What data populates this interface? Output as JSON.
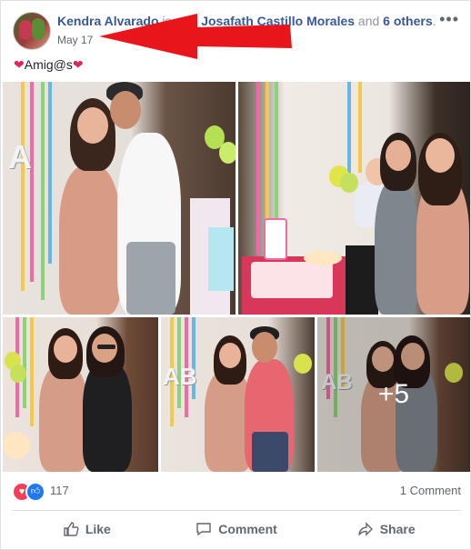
{
  "post": {
    "author": "Kendra Alvarado",
    "with_text": "is with",
    "tagged": "Josafath Castillo Morales",
    "and_text": "and",
    "others": "6 others",
    "end_punct": ".",
    "date": "May 17",
    "caption_text": "Amig@s",
    "more_icon": "ellipsis-icon"
  },
  "photos": {
    "overflow_label": "+5",
    "count_visible": 5
  },
  "reactions": {
    "icons": [
      "love-icon",
      "like-icon"
    ],
    "count": "117",
    "comments": "1 Comment"
  },
  "actions": {
    "like": "Like",
    "comment": "Comment",
    "share": "Share"
  },
  "colors": {
    "author": "#385898",
    "like_blue": "#2078f4",
    "love_red": "#f33e58",
    "annotation_arrow": "#e8151b"
  }
}
